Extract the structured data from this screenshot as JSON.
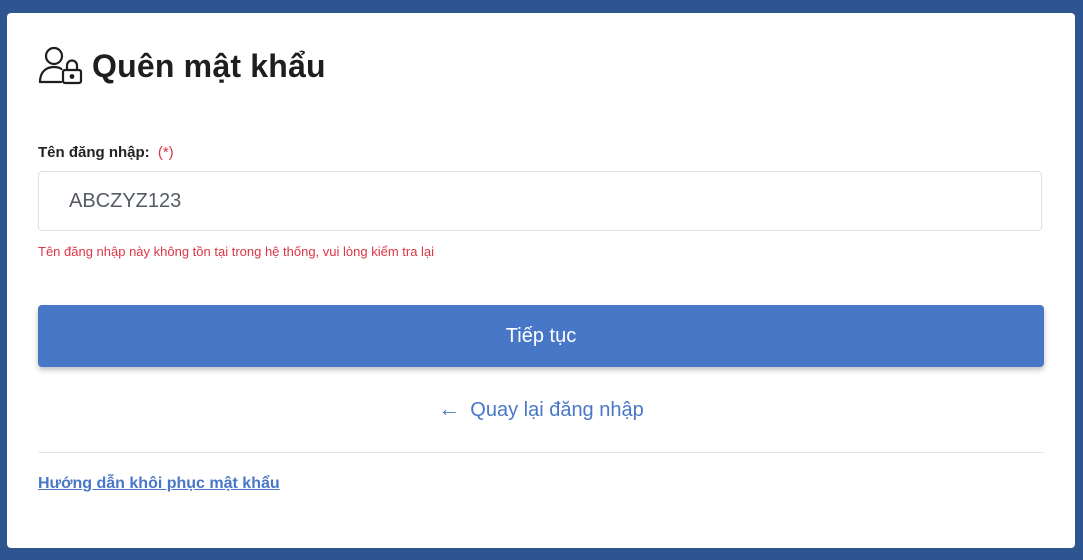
{
  "page": {
    "title": "Quên mật khẩu",
    "title_icon": "user-lock-icon"
  },
  "form": {
    "username_label": "Tên đăng nhập:",
    "required_marker": "(*)",
    "username_value": "ABCZYZ123",
    "error_message": "Tên đăng nhập này không tồn tại trong hệ thống, vui lòng kiểm tra lại",
    "continue_label": "Tiếp tục",
    "back_arrow": "←",
    "back_label": "Quay lại đăng nhập"
  },
  "footer": {
    "help_link": "Hướng dẫn khôi phục mật khẩu"
  },
  "colors": {
    "primary": "#4877c8",
    "error": "#dc3545",
    "background": "#2f5590"
  }
}
